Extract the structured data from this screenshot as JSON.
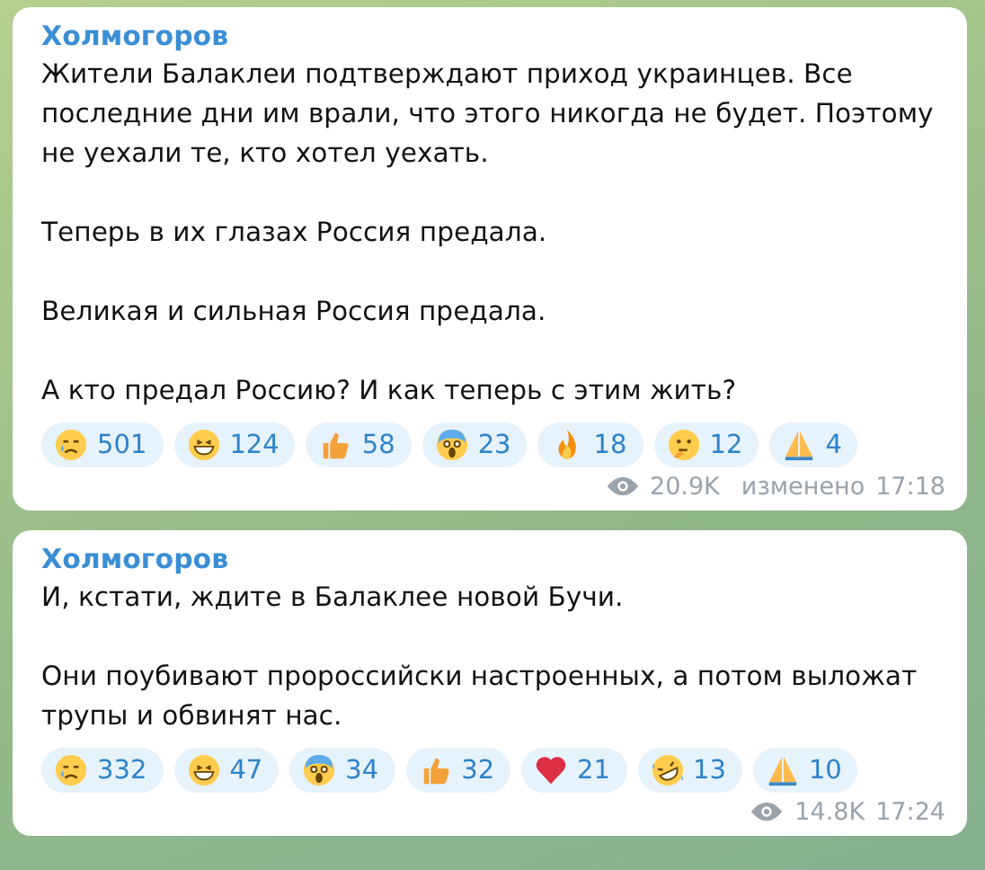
{
  "messages": [
    {
      "author": "Холмогоров",
      "paragraphs": [
        "Жители Балаклеи подтверждают приход украинцев. Все последние дни им врали, что этого никогда не будет. Поэтому не уехали те, кто хотел уехать.",
        "Теперь в их глазах Россия предала.",
        "Великая и сильная Россия предала.",
        "А кто предал Россию? И как теперь с этим жить?"
      ],
      "reactions": [
        {
          "kind": "crying",
          "count": "501"
        },
        {
          "kind": "grin",
          "count": "124"
        },
        {
          "kind": "thumbs-up",
          "count": "58"
        },
        {
          "kind": "scream",
          "count": "23"
        },
        {
          "kind": "fire",
          "count": "18"
        },
        {
          "kind": "thinking",
          "count": "12"
        },
        {
          "kind": "pray",
          "count": "4"
        }
      ],
      "views": "20.9K",
      "edited": "изменено",
      "time": "17:18"
    },
    {
      "author": "Холмогоров",
      "paragraphs": [
        "И, кстати, ждите в Балаклее новой Бучи.",
        "Они поубивают пророссийски настроенных, а потом выложат трупы и обвинят нас."
      ],
      "reactions": [
        {
          "kind": "crying",
          "count": "332"
        },
        {
          "kind": "grin",
          "count": "47"
        },
        {
          "kind": "scream",
          "count": "34"
        },
        {
          "kind": "thumbs-up",
          "count": "32"
        },
        {
          "kind": "heart",
          "count": "21"
        },
        {
          "kind": "rofl",
          "count": "13"
        },
        {
          "kind": "pray",
          "count": "10"
        }
      ],
      "views": "14.8K",
      "time": "17:24"
    }
  ]
}
